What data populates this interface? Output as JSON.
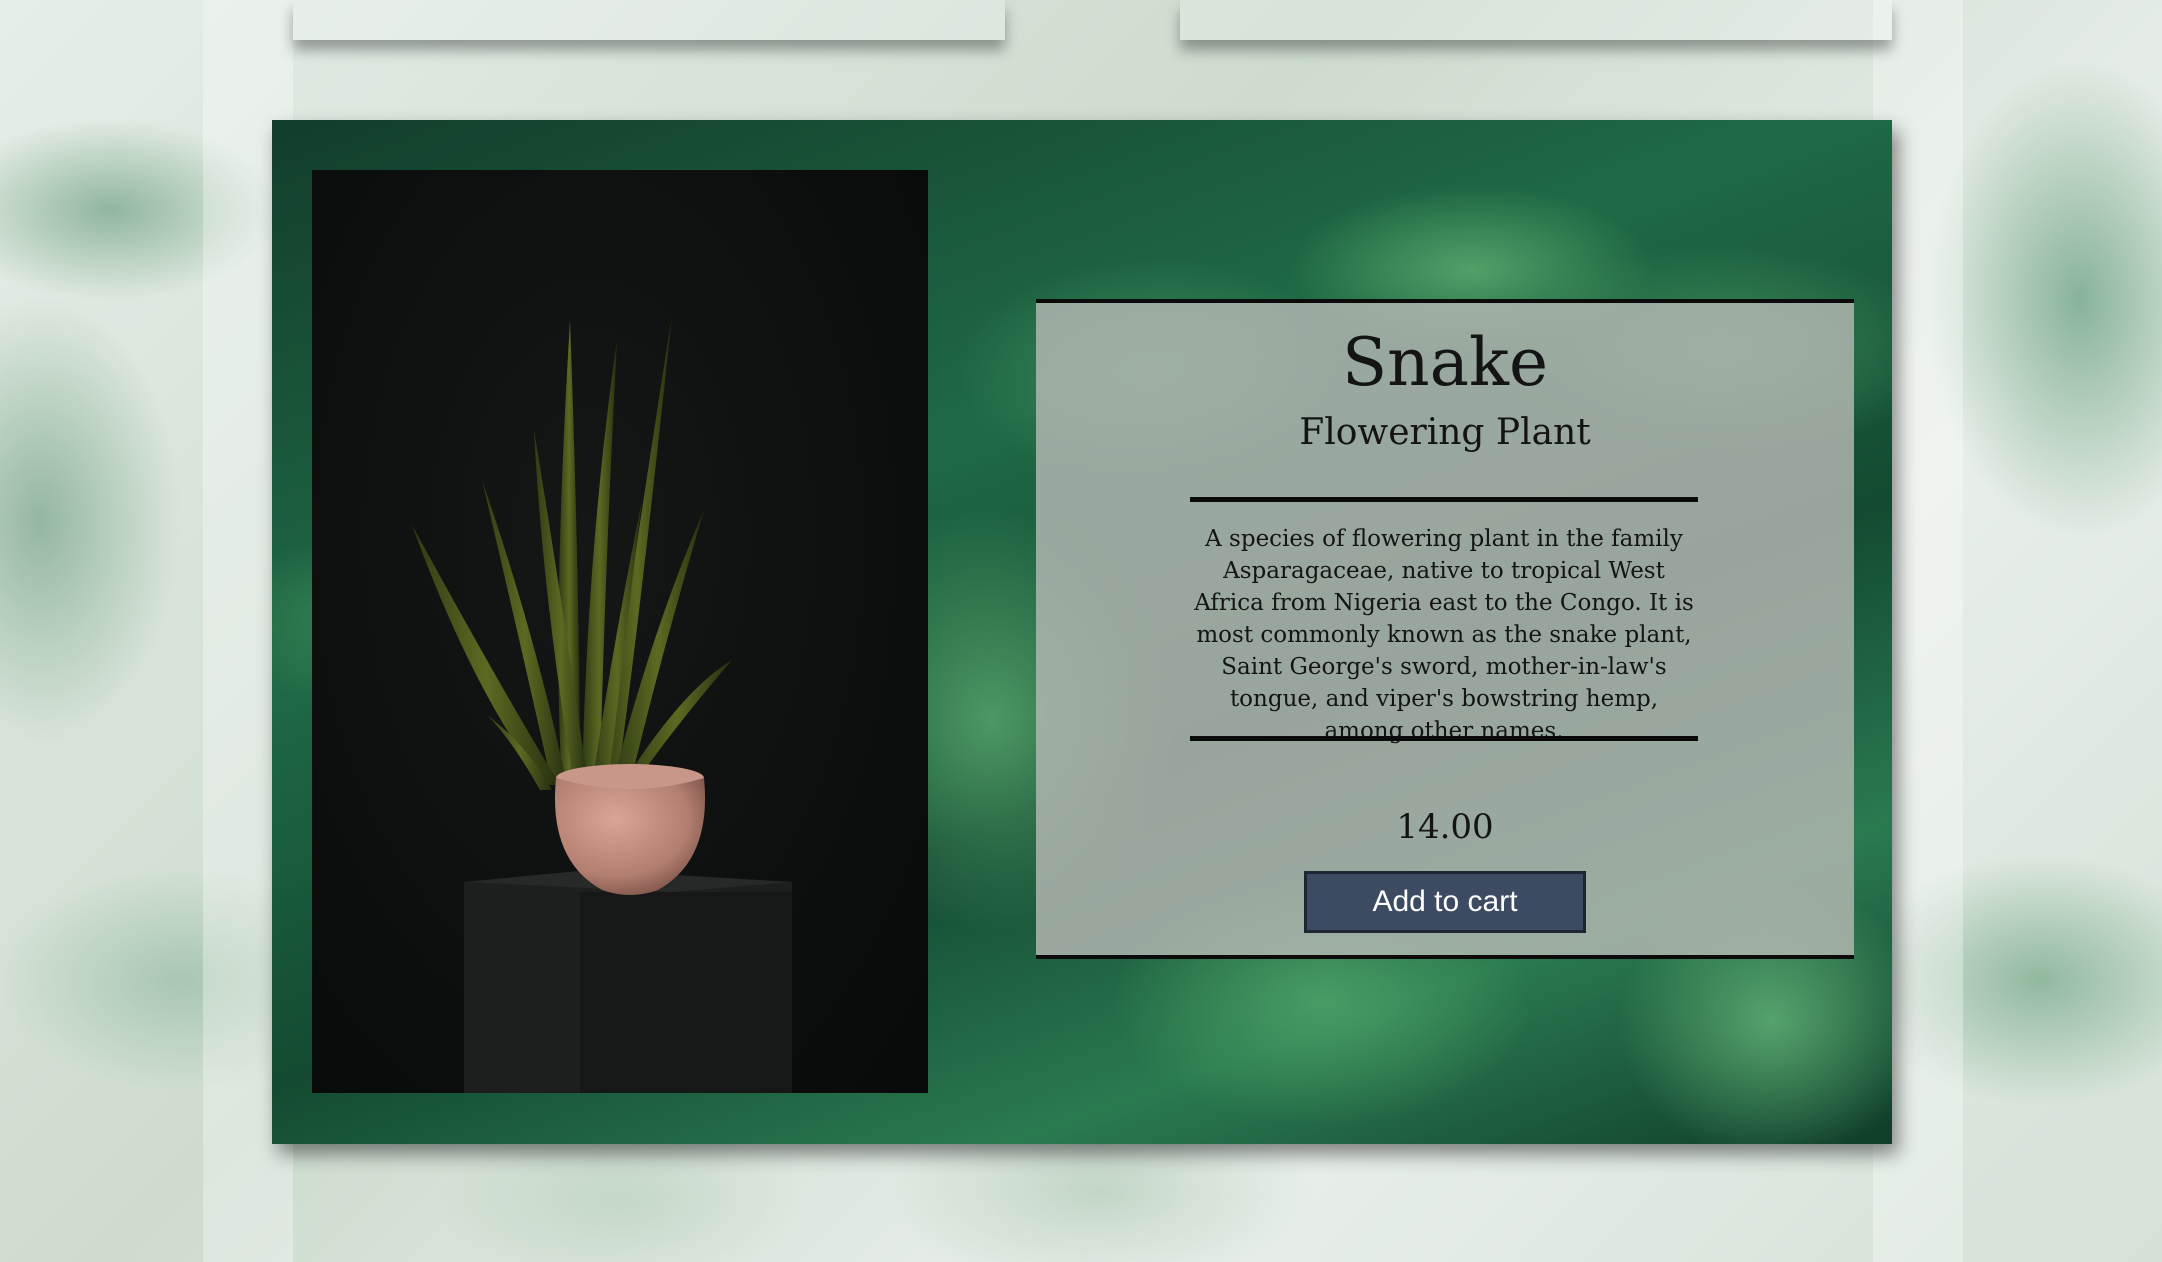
{
  "product": {
    "name": "Snake",
    "category": "Flowering Plant",
    "description": "A species of flowering plant in the family Asparagaceae, native to tropical West Africa from Nigeria east to the Congo. It is most commonly known as the snake plant, Saint George's sword, mother-in-law's tongue, and viper's bowstring hemp, among other names.",
    "price": "14.00",
    "add_to_cart_label": "Add to cart",
    "image_icon": "snake-plant-photo"
  },
  "colors": {
    "button": "#3d4b62",
    "panel": "#afb4af",
    "card": "#1f6a45"
  }
}
